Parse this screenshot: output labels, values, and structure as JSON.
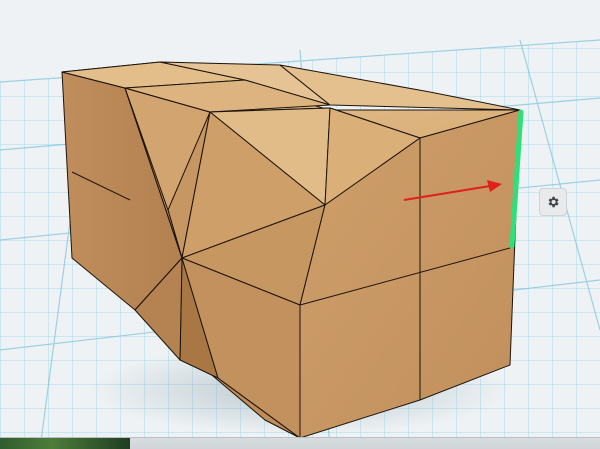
{
  "viewport": {
    "grid_color": "#8ecfe6",
    "background": "#eef2f4"
  },
  "model": {
    "material": "wood",
    "face_light": "#e0b985",
    "face_mid": "#cd9c67",
    "face_dark": "#b98a5a",
    "edge_color": "#1c140c",
    "selected_edge_color": "#2ee07a",
    "move_arrow_color": "#e0211b"
  },
  "toolbar": {
    "settings_icon": "gear-icon"
  },
  "status": {
    "thumbnail": "texture-thumbnail"
  }
}
